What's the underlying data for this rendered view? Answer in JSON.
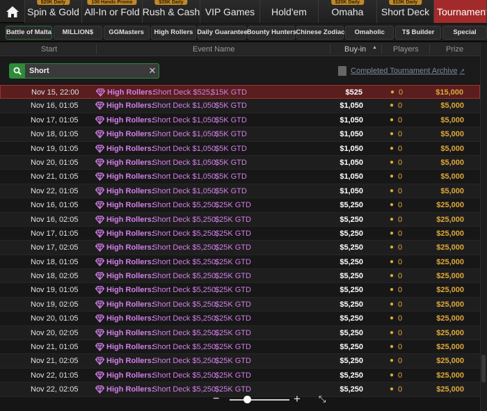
{
  "topbar": {
    "tabs": [
      {
        "label": "Spin & Gold",
        "badge": "$20K Daily",
        "active": false
      },
      {
        "label": "All-In or Fold",
        "badge": "100 Hands Promo",
        "active": false
      },
      {
        "label": "Rush & Cash",
        "badge": "$35K Daily",
        "active": false
      },
      {
        "label": "VIP Games",
        "badge": "",
        "active": false
      },
      {
        "label": "Hold'em",
        "badge": "",
        "active": false
      },
      {
        "label": "Omaha",
        "badge": "$20K Daily",
        "active": false
      },
      {
        "label": "Short Deck",
        "badge": "$10K Daily",
        "active": false
      },
      {
        "label": "Tournament",
        "badge": "",
        "active": true
      }
    ]
  },
  "subtabs": [
    "Battle of Malta",
    "MILLION$",
    "GGMasters",
    "High Rollers",
    "Daily Guarantee",
    "Bounty Hunters",
    "Chinese Zodiac",
    "Omaholic",
    "T$ Builder",
    "Special"
  ],
  "columns": {
    "start": "Start",
    "event_name": "Event Name",
    "buyin": "Buy-in",
    "players": "Players",
    "prize": "Prize"
  },
  "search": {
    "value": "Short",
    "archive_label": "Completed Tournament Archive"
  },
  "rows": [
    {
      "start": "Nov 15, 22:00",
      "category": "High Rollers:",
      "name": "Short Deck $525,",
      "gtd": "$15K GTD",
      "buyin": "$525",
      "players": "0",
      "prize": "$15,000",
      "selected": true
    },
    {
      "start": "Nov 16, 01:05",
      "category": "High Rollers:",
      "name": "Short Deck $1,050,",
      "gtd": "$5K GTD",
      "buyin": "$1,050",
      "players": "0",
      "prize": "$5,000"
    },
    {
      "start": "Nov 17, 01:05",
      "category": "High Rollers:",
      "name": "Short Deck $1,050,",
      "gtd": "$5K GTD",
      "buyin": "$1,050",
      "players": "0",
      "prize": "$5,000"
    },
    {
      "start": "Nov 18, 01:05",
      "category": "High Rollers:",
      "name": "Short Deck $1,050,",
      "gtd": "$5K GTD",
      "buyin": "$1,050",
      "players": "0",
      "prize": "$5,000"
    },
    {
      "start": "Nov 19, 01:05",
      "category": "High Rollers:",
      "name": "Short Deck $1,050,",
      "gtd": "$5K GTD",
      "buyin": "$1,050",
      "players": "0",
      "prize": "$5,000"
    },
    {
      "start": "Nov 20, 01:05",
      "category": "High Rollers:",
      "name": "Short Deck $1,050,",
      "gtd": "$5K GTD",
      "buyin": "$1,050",
      "players": "0",
      "prize": "$5,000"
    },
    {
      "start": "Nov 21, 01:05",
      "category": "High Rollers:",
      "name": "Short Deck $1,050,",
      "gtd": "$5K GTD",
      "buyin": "$1,050",
      "players": "0",
      "prize": "$5,000"
    },
    {
      "start": "Nov 22, 01:05",
      "category": "High Rollers:",
      "name": "Short Deck $1,050,",
      "gtd": "$5K GTD",
      "buyin": "$1,050",
      "players": "0",
      "prize": "$5,000"
    },
    {
      "start": "Nov 16, 01:05",
      "category": "High Rollers:",
      "name": "Short Deck $5,250,",
      "gtd": "$25K GTD",
      "buyin": "$5,250",
      "players": "0",
      "prize": "$25,000"
    },
    {
      "start": "Nov 16, 02:05",
      "category": "High Rollers:",
      "name": "Short Deck $5,250,",
      "gtd": "$25K GTD",
      "buyin": "$5,250",
      "players": "0",
      "prize": "$25,000"
    },
    {
      "start": "Nov 17, 01:05",
      "category": "High Rollers:",
      "name": "Short Deck $5,250,",
      "gtd": "$25K GTD",
      "buyin": "$5,250",
      "players": "0",
      "prize": "$25,000"
    },
    {
      "start": "Nov 17, 02:05",
      "category": "High Rollers:",
      "name": "Short Deck $5,250,",
      "gtd": "$25K GTD",
      "buyin": "$5,250",
      "players": "0",
      "prize": "$25,000"
    },
    {
      "start": "Nov 18, 01:05",
      "category": "High Rollers:",
      "name": "Short Deck $5,250,",
      "gtd": "$25K GTD",
      "buyin": "$5,250",
      "players": "0",
      "prize": "$25,000"
    },
    {
      "start": "Nov 18, 02:05",
      "category": "High Rollers:",
      "name": "Short Deck $5,250,",
      "gtd": "$25K GTD",
      "buyin": "$5,250",
      "players": "0",
      "prize": "$25,000"
    },
    {
      "start": "Nov 19, 01:05",
      "category": "High Rollers:",
      "name": "Short Deck $5,250,",
      "gtd": "$25K GTD",
      "buyin": "$5,250",
      "players": "0",
      "prize": "$25,000"
    },
    {
      "start": "Nov 19, 02:05",
      "category": "High Rollers:",
      "name": "Short Deck $5,250,",
      "gtd": "$25K GTD",
      "buyin": "$5,250",
      "players": "0",
      "prize": "$25,000"
    },
    {
      "start": "Nov 20, 01:05",
      "category": "High Rollers:",
      "name": "Short Deck $5,250,",
      "gtd": "$25K GTD",
      "buyin": "$5,250",
      "players": "0",
      "prize": "$25,000"
    },
    {
      "start": "Nov 20, 02:05",
      "category": "High Rollers:",
      "name": "Short Deck $5,250,",
      "gtd": "$25K GTD",
      "buyin": "$5,250",
      "players": "0",
      "prize": "$25,000"
    },
    {
      "start": "Nov 21, 01:05",
      "category": "High Rollers:",
      "name": "Short Deck $5,250,",
      "gtd": "$25K GTD",
      "buyin": "$5,250",
      "players": "0",
      "prize": "$25,000"
    },
    {
      "start": "Nov 21, 02:05",
      "category": "High Rollers:",
      "name": "Short Deck $5,250,",
      "gtd": "$25K GTD",
      "buyin": "$5,250",
      "players": "0",
      "prize": "$25,000"
    },
    {
      "start": "Nov 22, 01:05",
      "category": "High Rollers:",
      "name": "Short Deck $5,250,",
      "gtd": "$25K GTD",
      "buyin": "$5,250",
      "players": "0",
      "prize": "$25,000"
    },
    {
      "start": "Nov 22, 02:05",
      "category": "High Rollers:",
      "name": "Short Deck $5,250,",
      "gtd": "$25K GTD",
      "buyin": "$5,250",
      "players": "0",
      "prize": "$25,000"
    }
  ],
  "zoom": {
    "minus": "−",
    "plus": "+",
    "level": 0.3
  },
  "colors": {
    "accent_red": "#a32a2a",
    "gem_purple": "#d27fe8",
    "prize_gold": "#e0a93a",
    "search_green": "#2e8b3a"
  }
}
